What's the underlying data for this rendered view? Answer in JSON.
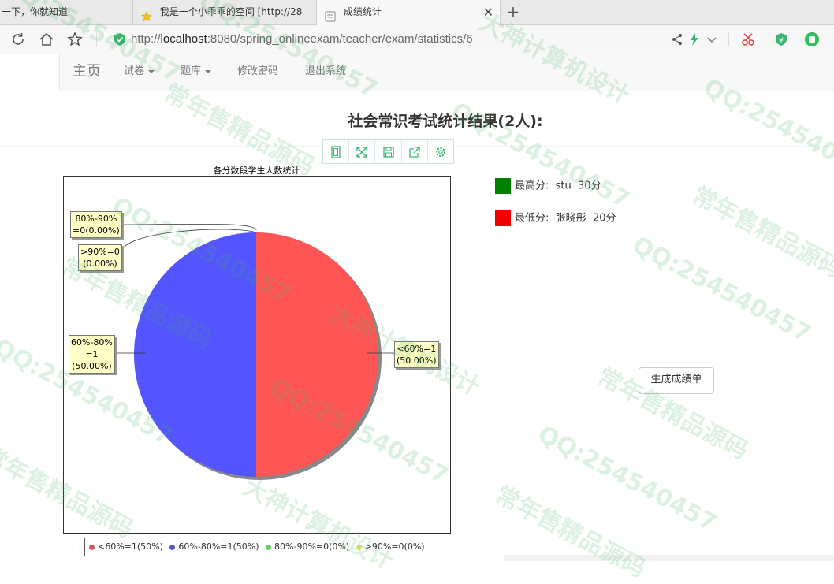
{
  "browser": {
    "tabs": [
      {
        "label": "一下，你就知道",
        "active": false
      },
      {
        "label": "我是一个小乖乖的空间 [http://28",
        "active": false
      },
      {
        "label": "成绩统计",
        "active": true
      }
    ],
    "new_tab": "+",
    "close": "✕",
    "url_prefix": "http://",
    "url_host": "localhost",
    "url_rest": ":8080/spring_onlineexam/teacher/exam/statistics/6"
  },
  "nav": {
    "brand": "主页",
    "items": [
      {
        "label": "试卷",
        "dropdown": true
      },
      {
        "label": "题库",
        "dropdown": true
      },
      {
        "label": "修改密码",
        "dropdown": false
      },
      {
        "label": "退出系统",
        "dropdown": false
      }
    ]
  },
  "page": {
    "heading": "社会常识考试统计结果(2人):"
  },
  "chart_data": {
    "type": "pie",
    "title": "各分数段学生人数统计",
    "slices": [
      {
        "name": "<60%",
        "value": 1,
        "percent": 50.0,
        "color": "#ff5555",
        "label": "<60%=1\n(50.00%)"
      },
      {
        "name": "60%-80%",
        "value": 1,
        "percent": 50.0,
        "color": "#5555ff",
        "label": "60%-80%\n=1\n(50.00%)"
      },
      {
        "name": "80%-90%",
        "value": 0,
        "percent": 0.0,
        "color": "#55ff55",
        "label": "80%-90%\n=0(0.00%)"
      },
      {
        "name": ">90%",
        "value": 0,
        "percent": 0.0,
        "color": "#ffff55",
        "label": ">90%=0\n(0.00%)"
      }
    ],
    "legend": [
      {
        "text": "<60%=1(50%)",
        "color": "#d45a5a"
      },
      {
        "text": "60%-80%=1(50%)",
        "color": "#5555c8"
      },
      {
        "text": "80%-90%=0(0%)",
        "color": "#66cc66"
      },
      {
        "text": ">90%=0(0%)",
        "color": "#e6e66e"
      }
    ],
    "legend_position": "bottom"
  },
  "stats": {
    "highest": {
      "label": "最高分:",
      "name": "stu",
      "score": "30分",
      "color": "#008000"
    },
    "lowest": {
      "label": "最低分:",
      "name": "张晓彤",
      "score": "20分",
      "color": "#ee0000"
    }
  },
  "actions": {
    "generate_label": "生成成绩单"
  },
  "watermarks": {
    "qq": "QQ:254540457",
    "a": "常年售精品源码",
    "b": "大神计算机设计"
  }
}
